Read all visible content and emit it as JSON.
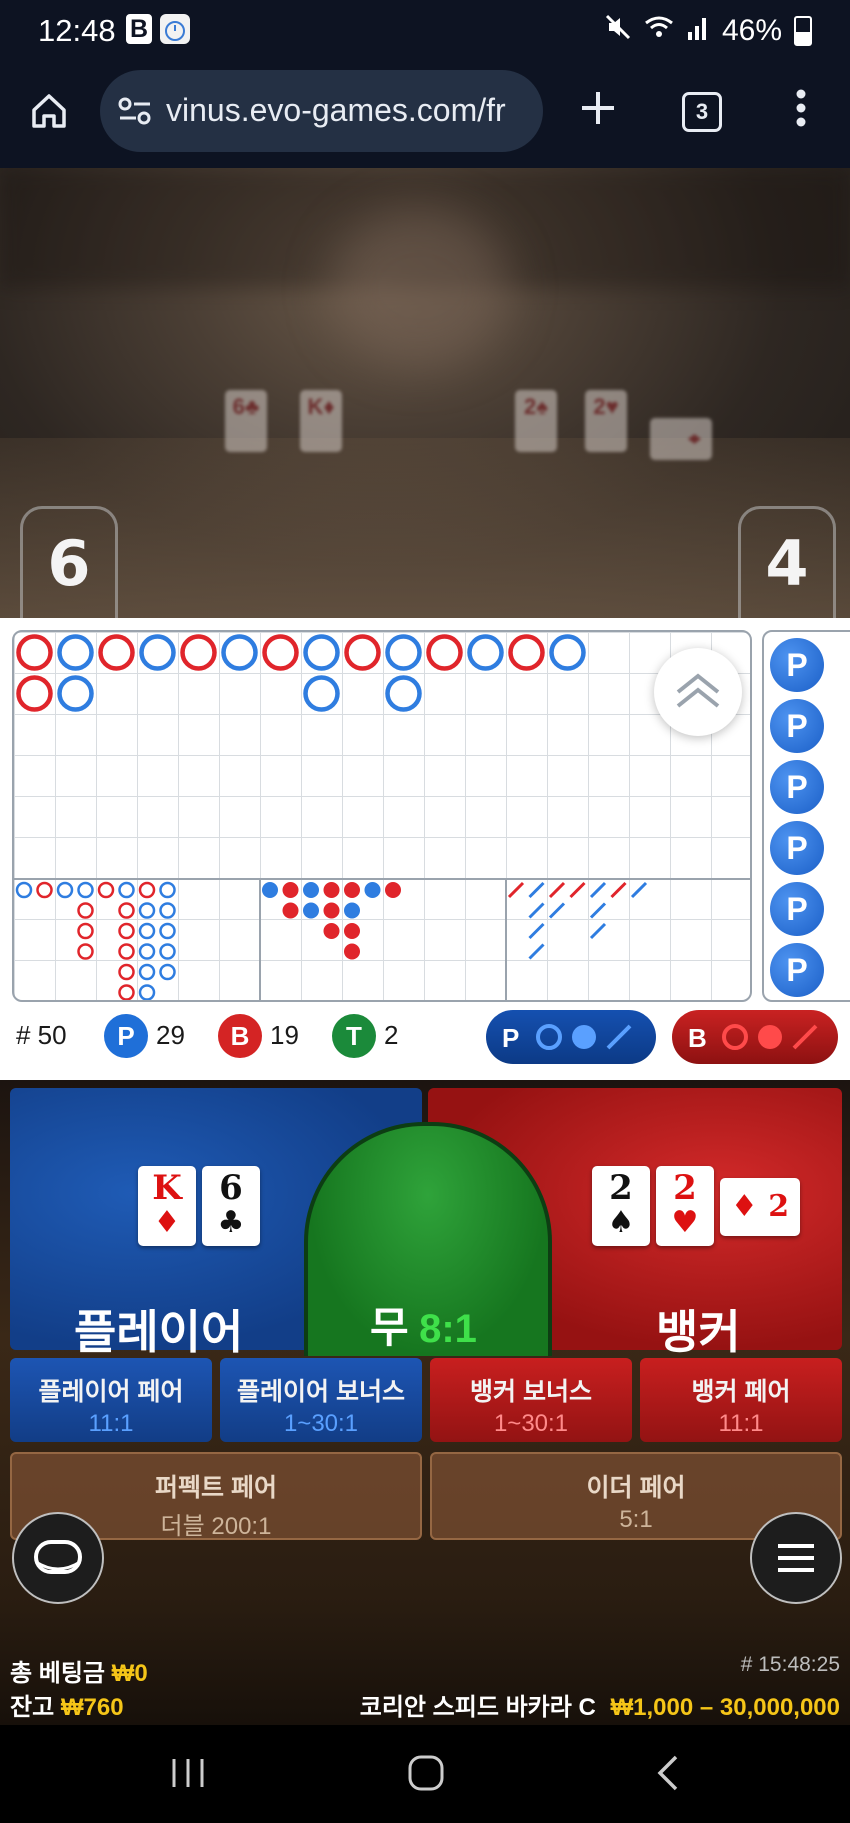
{
  "status_bar": {
    "time": "12:48",
    "b_icon": "B",
    "battery": "46%"
  },
  "browser": {
    "url": "vinus.evo-games.com/fr",
    "tab_count": "3"
  },
  "video": {
    "player_score": "6",
    "banker_score": "4",
    "player_cards_blurred": [
      "6♣",
      "K♦"
    ],
    "banker_cards_blurred": [
      "2♠",
      "2♥",
      "♦"
    ]
  },
  "bead_road": [
    {
      "col": 0,
      "row": 0,
      "c": "B"
    },
    {
      "col": 0,
      "row": 1,
      "c": "B"
    },
    {
      "col": 1,
      "row": 0,
      "c": "P"
    },
    {
      "col": 1,
      "row": 1,
      "c": "P"
    },
    {
      "col": 2,
      "row": 0,
      "c": "B"
    },
    {
      "col": 3,
      "row": 0,
      "c": "P"
    },
    {
      "col": 4,
      "row": 0,
      "c": "B"
    },
    {
      "col": 5,
      "row": 0,
      "c": "P"
    },
    {
      "col": 6,
      "row": 0,
      "c": "B"
    },
    {
      "col": 7,
      "row": 0,
      "c": "P"
    },
    {
      "col": 7,
      "row": 1,
      "c": "P"
    },
    {
      "col": 8,
      "row": 0,
      "c": "B"
    },
    {
      "col": 9,
      "row": 0,
      "c": "P"
    },
    {
      "col": 9,
      "row": 1,
      "c": "P"
    },
    {
      "col": 10,
      "row": 0,
      "c": "B"
    },
    {
      "col": 11,
      "row": 0,
      "c": "P"
    },
    {
      "col": 12,
      "row": 0,
      "c": "B"
    },
    {
      "col": 13,
      "row": 0,
      "c": "P"
    }
  ],
  "side_panel": {
    "chips": [
      "P",
      "P",
      "P",
      "P",
      "P",
      "P"
    ]
  },
  "stats": {
    "hash": "# 50",
    "player_label": "P",
    "player_count": "29",
    "banker_label": "B",
    "banker_count": "19",
    "tie_label": "T",
    "tie_count": "2"
  },
  "predict": {
    "player_label": "P",
    "banker_label": "B"
  },
  "bets": {
    "player": {
      "label": "플레이어",
      "cards": [
        {
          "r": "K",
          "s": "♦",
          "red": true
        },
        {
          "r": "6",
          "s": "♣",
          "red": false
        }
      ]
    },
    "tie": {
      "label": "무",
      "odds": "8:1"
    },
    "banker": {
      "label": "뱅커",
      "cards": [
        {
          "r": "2",
          "s": "♠",
          "red": false
        },
        {
          "r": "2",
          "s": "♥",
          "red": true
        }
      ]
    },
    "player_pair": {
      "label": "플레이어 페어",
      "odds": "11:1"
    },
    "player_bonus": {
      "label": "플레이어 보너스",
      "odds": "1~30:1"
    },
    "banker_bonus": {
      "label": "뱅커 보너스",
      "odds": "1~30:1"
    },
    "banker_pair": {
      "label": "뱅커 페어",
      "odds": "11:1"
    },
    "perfect_pair": {
      "label": "퍼펙트 페어",
      "odds": "더블 200:1"
    },
    "either_pair": {
      "label": "이더 페어",
      "odds": "5:1"
    }
  },
  "footer": {
    "total_bet_label": "총 베팅금",
    "total_bet_value": "₩0",
    "balance_label": "잔고",
    "balance_value": "₩760",
    "round_id": "# 15:48:25",
    "table_name": "코리안 스피드 바카라 C",
    "limits": "₩1,000 – 30,000,000"
  },
  "colors": {
    "player": "#1f5bb5",
    "banker": "#c81f1f",
    "tie": "#1b8a28",
    "gold": "#f5c518"
  }
}
